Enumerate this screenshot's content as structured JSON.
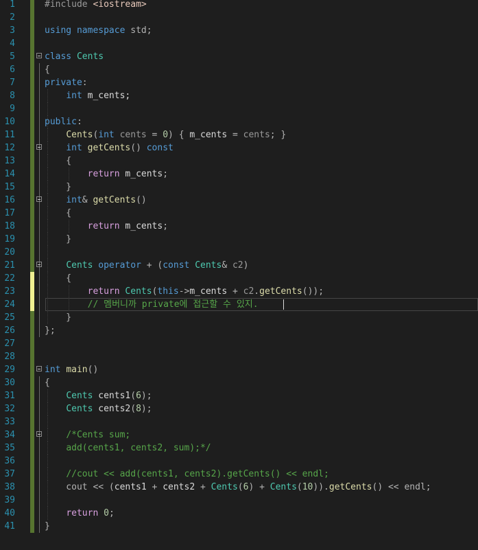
{
  "editor": {
    "lines": [
      {
        "num": "1",
        "tokens": [
          [
            "#include ",
            "pp"
          ],
          [
            "<iostream>",
            "inc"
          ]
        ]
      },
      {
        "num": "2",
        "tokens": []
      },
      {
        "num": "3",
        "tokens": [
          [
            "using",
            "kw"
          ],
          [
            " ",
            "op"
          ],
          [
            "namespace",
            "kw"
          ],
          [
            " std;",
            "op"
          ]
        ]
      },
      {
        "num": "4",
        "tokens": []
      },
      {
        "num": "5",
        "tokens": [
          [
            "class",
            "kw"
          ],
          [
            " ",
            "op"
          ],
          [
            "Cents",
            "ty"
          ]
        ]
      },
      {
        "num": "6",
        "tokens": [
          [
            "{",
            "op"
          ]
        ]
      },
      {
        "num": "7",
        "tokens": [
          [
            "private",
            "kw"
          ],
          [
            ":",
            "op"
          ]
        ]
      },
      {
        "num": "8",
        "tokens": [
          [
            "    ",
            "op"
          ],
          [
            "int",
            "kw"
          ],
          [
            " m_cents;",
            "mv"
          ]
        ]
      },
      {
        "num": "9",
        "tokens": []
      },
      {
        "num": "10",
        "tokens": [
          [
            "public",
            "kw"
          ],
          [
            ":",
            "op"
          ]
        ]
      },
      {
        "num": "11",
        "tokens": [
          [
            "    ",
            "op"
          ],
          [
            "Cents",
            "fn"
          ],
          [
            "(",
            "op"
          ],
          [
            "int",
            "kw"
          ],
          [
            " ",
            "op"
          ],
          [
            "cents",
            "pm"
          ],
          [
            " = ",
            "op"
          ],
          [
            "0",
            "num"
          ],
          [
            ") { ",
            "op"
          ],
          [
            "m_cents",
            "mv"
          ],
          [
            " = ",
            "op"
          ],
          [
            "cents",
            "pm"
          ],
          [
            "; }",
            "op"
          ]
        ]
      },
      {
        "num": "12",
        "tokens": [
          [
            "    ",
            "op"
          ],
          [
            "int",
            "kw"
          ],
          [
            " ",
            "op"
          ],
          [
            "getCents",
            "fn"
          ],
          [
            "() ",
            "op"
          ],
          [
            "const",
            "kw"
          ]
        ]
      },
      {
        "num": "13",
        "tokens": [
          [
            "    {",
            "op"
          ]
        ]
      },
      {
        "num": "14",
        "tokens": [
          [
            "        ",
            "op"
          ],
          [
            "return",
            "kw2"
          ],
          [
            " ",
            "op"
          ],
          [
            "m_cents",
            "mv"
          ],
          [
            ";",
            "op"
          ]
        ]
      },
      {
        "num": "15",
        "tokens": [
          [
            "    }",
            "op"
          ]
        ]
      },
      {
        "num": "16",
        "tokens": [
          [
            "    ",
            "op"
          ],
          [
            "int",
            "kw"
          ],
          [
            "& ",
            "op"
          ],
          [
            "getCents",
            "fn"
          ],
          [
            "()",
            "op"
          ]
        ]
      },
      {
        "num": "17",
        "tokens": [
          [
            "    {",
            "op"
          ]
        ]
      },
      {
        "num": "18",
        "tokens": [
          [
            "        ",
            "op"
          ],
          [
            "return",
            "kw2"
          ],
          [
            " ",
            "op"
          ],
          [
            "m_cents",
            "mv"
          ],
          [
            ";",
            "op"
          ]
        ]
      },
      {
        "num": "19",
        "tokens": [
          [
            "    }",
            "op"
          ]
        ]
      },
      {
        "num": "20",
        "tokens": []
      },
      {
        "num": "21",
        "tokens": [
          [
            "    ",
            "op"
          ],
          [
            "Cents",
            "ty"
          ],
          [
            " ",
            "op"
          ],
          [
            "operator",
            "kw"
          ],
          [
            " + (",
            "op"
          ],
          [
            "const",
            "kw"
          ],
          [
            " ",
            "op"
          ],
          [
            "Cents",
            "ty"
          ],
          [
            "& ",
            "op"
          ],
          [
            "c2",
            "pm"
          ],
          [
            ")",
            "op"
          ]
        ]
      },
      {
        "num": "22",
        "tokens": [
          [
            "    {",
            "op"
          ]
        ]
      },
      {
        "num": "23",
        "tokens": [
          [
            "        ",
            "op"
          ],
          [
            "return",
            "kw2"
          ],
          [
            " ",
            "op"
          ],
          [
            "Cents",
            "ty"
          ],
          [
            "(",
            "op"
          ],
          [
            "this",
            "kw"
          ],
          [
            "->",
            "op"
          ],
          [
            "m_cents",
            "mv"
          ],
          [
            " + ",
            "op"
          ],
          [
            "c2",
            "pm"
          ],
          [
            ".",
            "op"
          ],
          [
            "getCents",
            "fn"
          ],
          [
            "());",
            "op"
          ]
        ]
      },
      {
        "num": "24",
        "tokens": [
          [
            "        ",
            "op"
          ],
          [
            "// 멤버니까 private에 접근할 수 있지.",
            "cm"
          ]
        ]
      },
      {
        "num": "25",
        "tokens": [
          [
            "    }",
            "op"
          ]
        ]
      },
      {
        "num": "26",
        "tokens": [
          [
            "};",
            "op"
          ]
        ]
      },
      {
        "num": "27",
        "tokens": []
      },
      {
        "num": "28",
        "tokens": []
      },
      {
        "num": "29",
        "tokens": [
          [
            "int",
            "kw"
          ],
          [
            " ",
            "op"
          ],
          [
            "main",
            "fn"
          ],
          [
            "()",
            "op"
          ]
        ]
      },
      {
        "num": "30",
        "tokens": [
          [
            "{",
            "op"
          ]
        ]
      },
      {
        "num": "31",
        "tokens": [
          [
            "    ",
            "op"
          ],
          [
            "Cents",
            "ty"
          ],
          [
            " ",
            "op"
          ],
          [
            "cents1",
            "mv"
          ],
          [
            "(",
            "op"
          ],
          [
            "6",
            "num"
          ],
          [
            ");",
            "op"
          ]
        ]
      },
      {
        "num": "32",
        "tokens": [
          [
            "    ",
            "op"
          ],
          [
            "Cents",
            "ty"
          ],
          [
            " ",
            "op"
          ],
          [
            "cents2",
            "mv"
          ],
          [
            "(",
            "op"
          ],
          [
            "8",
            "num"
          ],
          [
            ");",
            "op"
          ]
        ]
      },
      {
        "num": "33",
        "tokens": []
      },
      {
        "num": "34",
        "tokens": [
          [
            "    ",
            "op"
          ],
          [
            "/*Cents sum;",
            "cm"
          ]
        ]
      },
      {
        "num": "35",
        "tokens": [
          [
            "    ",
            "op"
          ],
          [
            "add(cents1, cents2, sum);*/",
            "cm"
          ]
        ]
      },
      {
        "num": "36",
        "tokens": []
      },
      {
        "num": "37",
        "tokens": [
          [
            "    ",
            "op"
          ],
          [
            "//cout << add(cents1, cents2).getCents() << endl;",
            "cm"
          ]
        ]
      },
      {
        "num": "38",
        "tokens": [
          [
            "    cout << (",
            "op"
          ],
          [
            "cents1",
            "mv"
          ],
          [
            " + ",
            "op"
          ],
          [
            "cents2",
            "mv"
          ],
          [
            " + ",
            "op"
          ],
          [
            "Cents",
            "ty"
          ],
          [
            "(",
            "op"
          ],
          [
            "6",
            "num"
          ],
          [
            ") + ",
            "op"
          ],
          [
            "Cents",
            "ty"
          ],
          [
            "(",
            "op"
          ],
          [
            "10",
            "num"
          ],
          [
            ")).",
            "op"
          ],
          [
            "getCents",
            "fn"
          ],
          [
            "() << endl;",
            "op"
          ]
        ]
      },
      {
        "num": "39",
        "tokens": []
      },
      {
        "num": "40",
        "tokens": [
          [
            "    ",
            "op"
          ],
          [
            "return",
            "kw2"
          ],
          [
            " ",
            "op"
          ],
          [
            "0",
            "num"
          ],
          [
            ";",
            "op"
          ]
        ]
      },
      {
        "num": "41",
        "tokens": [
          [
            "}",
            "op"
          ]
        ]
      }
    ]
  },
  "colors": {
    "background": "#1e1e1e",
    "line_number": "#2b91af",
    "saved_change_bar": "#577430",
    "unsaved_change_bar": "#efef91",
    "keyword": "#569cd6",
    "control_keyword": "#d8a0df",
    "type": "#4ec9b0",
    "function": "#dcdcaa",
    "number": "#b5cea8",
    "comment": "#57a64a"
  },
  "gutter": {
    "fold_lines": [
      5,
      12,
      16,
      21,
      29,
      34
    ],
    "unsaved_lines": [
      22,
      23,
      24
    ],
    "current_line": 24
  }
}
